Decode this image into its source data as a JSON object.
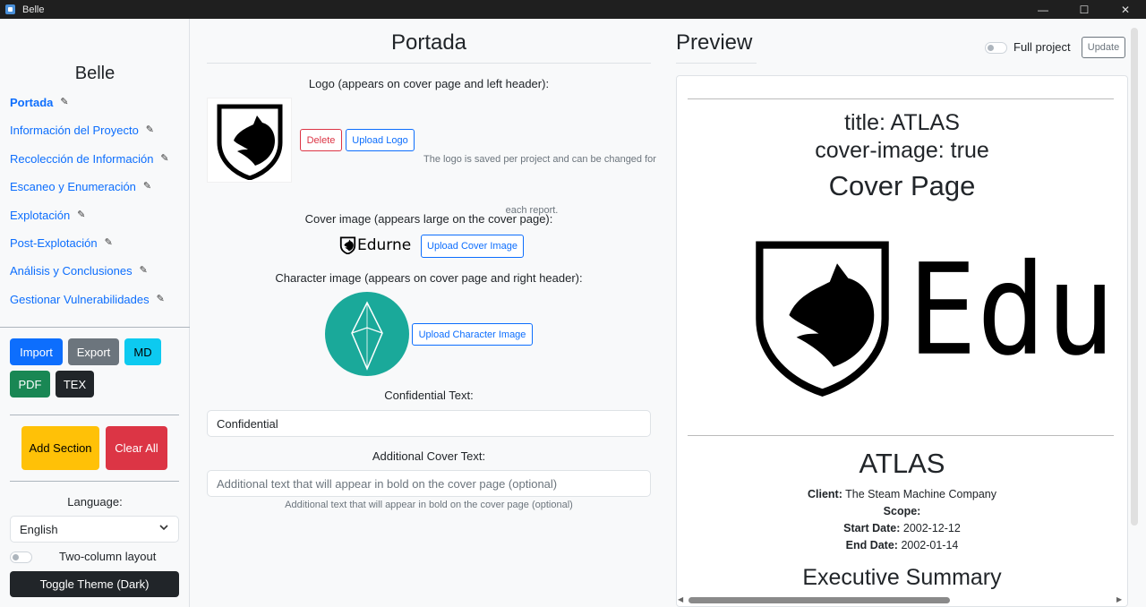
{
  "window": {
    "title": "Belle",
    "minimize": "—",
    "maximize": "☐",
    "close": "✕"
  },
  "sidebar": {
    "title": "Belle",
    "items": [
      {
        "label": "Portada",
        "active": true
      },
      {
        "label": "Información del Proyecto"
      },
      {
        "label": "Recolección de Información"
      },
      {
        "label": "Escaneo y Enumeración"
      },
      {
        "label": "Explotación"
      },
      {
        "label": "Post-Explotación"
      },
      {
        "label": "Análisis y Conclusiones"
      },
      {
        "label": "Gestionar Vulnerabilidades"
      }
    ],
    "edit_glyph": "✎",
    "buttons": {
      "import": "Import",
      "export": "Export",
      "md": "MD",
      "pdf": "PDF",
      "tex": "TEX"
    },
    "add_section": "Add Section",
    "clear_all": "Clear All",
    "language_label": "Language:",
    "language_value": "English",
    "two_column": "Two-column layout",
    "toggle_theme": "Toggle Theme (Dark)"
  },
  "editor": {
    "heading": "Portada",
    "logo_label": "Logo (appears on cover page and left header):",
    "delete_button": "Delete",
    "upload_logo": "Upload Logo",
    "logo_note": "The logo is saved per project and can be changed for each report.",
    "cover_label": "Cover image (appears large on the cover page):",
    "cover_word": "Edurne",
    "upload_cover": "Upload Cover Image",
    "character_label": "Character image (appears on cover page and right header):",
    "upload_character": "Upload Character Image",
    "confidential_label": "Confidential Text:",
    "confidential_value": "Confidential",
    "additional_label": "Additional Cover Text:",
    "additional_placeholder": "Additional text that will appear in bold on the cover page (optional)",
    "additional_help": "Additional text that will appear in bold on the cover page (optional)"
  },
  "preview": {
    "heading": "Preview",
    "full_project": "Full project",
    "update": "Update",
    "doc": {
      "fm_title": "title: ATLAS",
      "fm_cover": "cover-image: true",
      "cover_heading": "Cover Page",
      "cover_word": "Edu",
      "project": "ATLAS",
      "client_label": "Client:",
      "client_value": "The Steam Machine Company",
      "scope_label": "Scope:",
      "start_label": "Start Date:",
      "start_value": "2002-12-12",
      "end_label": "End Date:",
      "end_value": "2002-01-14",
      "exec_summary": "Executive Summary"
    }
  },
  "colors": {
    "primary": "#0d6efd",
    "secondary": "#6c757d",
    "info": "#0dcaf0",
    "success": "#198754",
    "dark": "#212529",
    "warning": "#ffc107",
    "danger": "#dc3545",
    "teal": "#1aa99a"
  }
}
